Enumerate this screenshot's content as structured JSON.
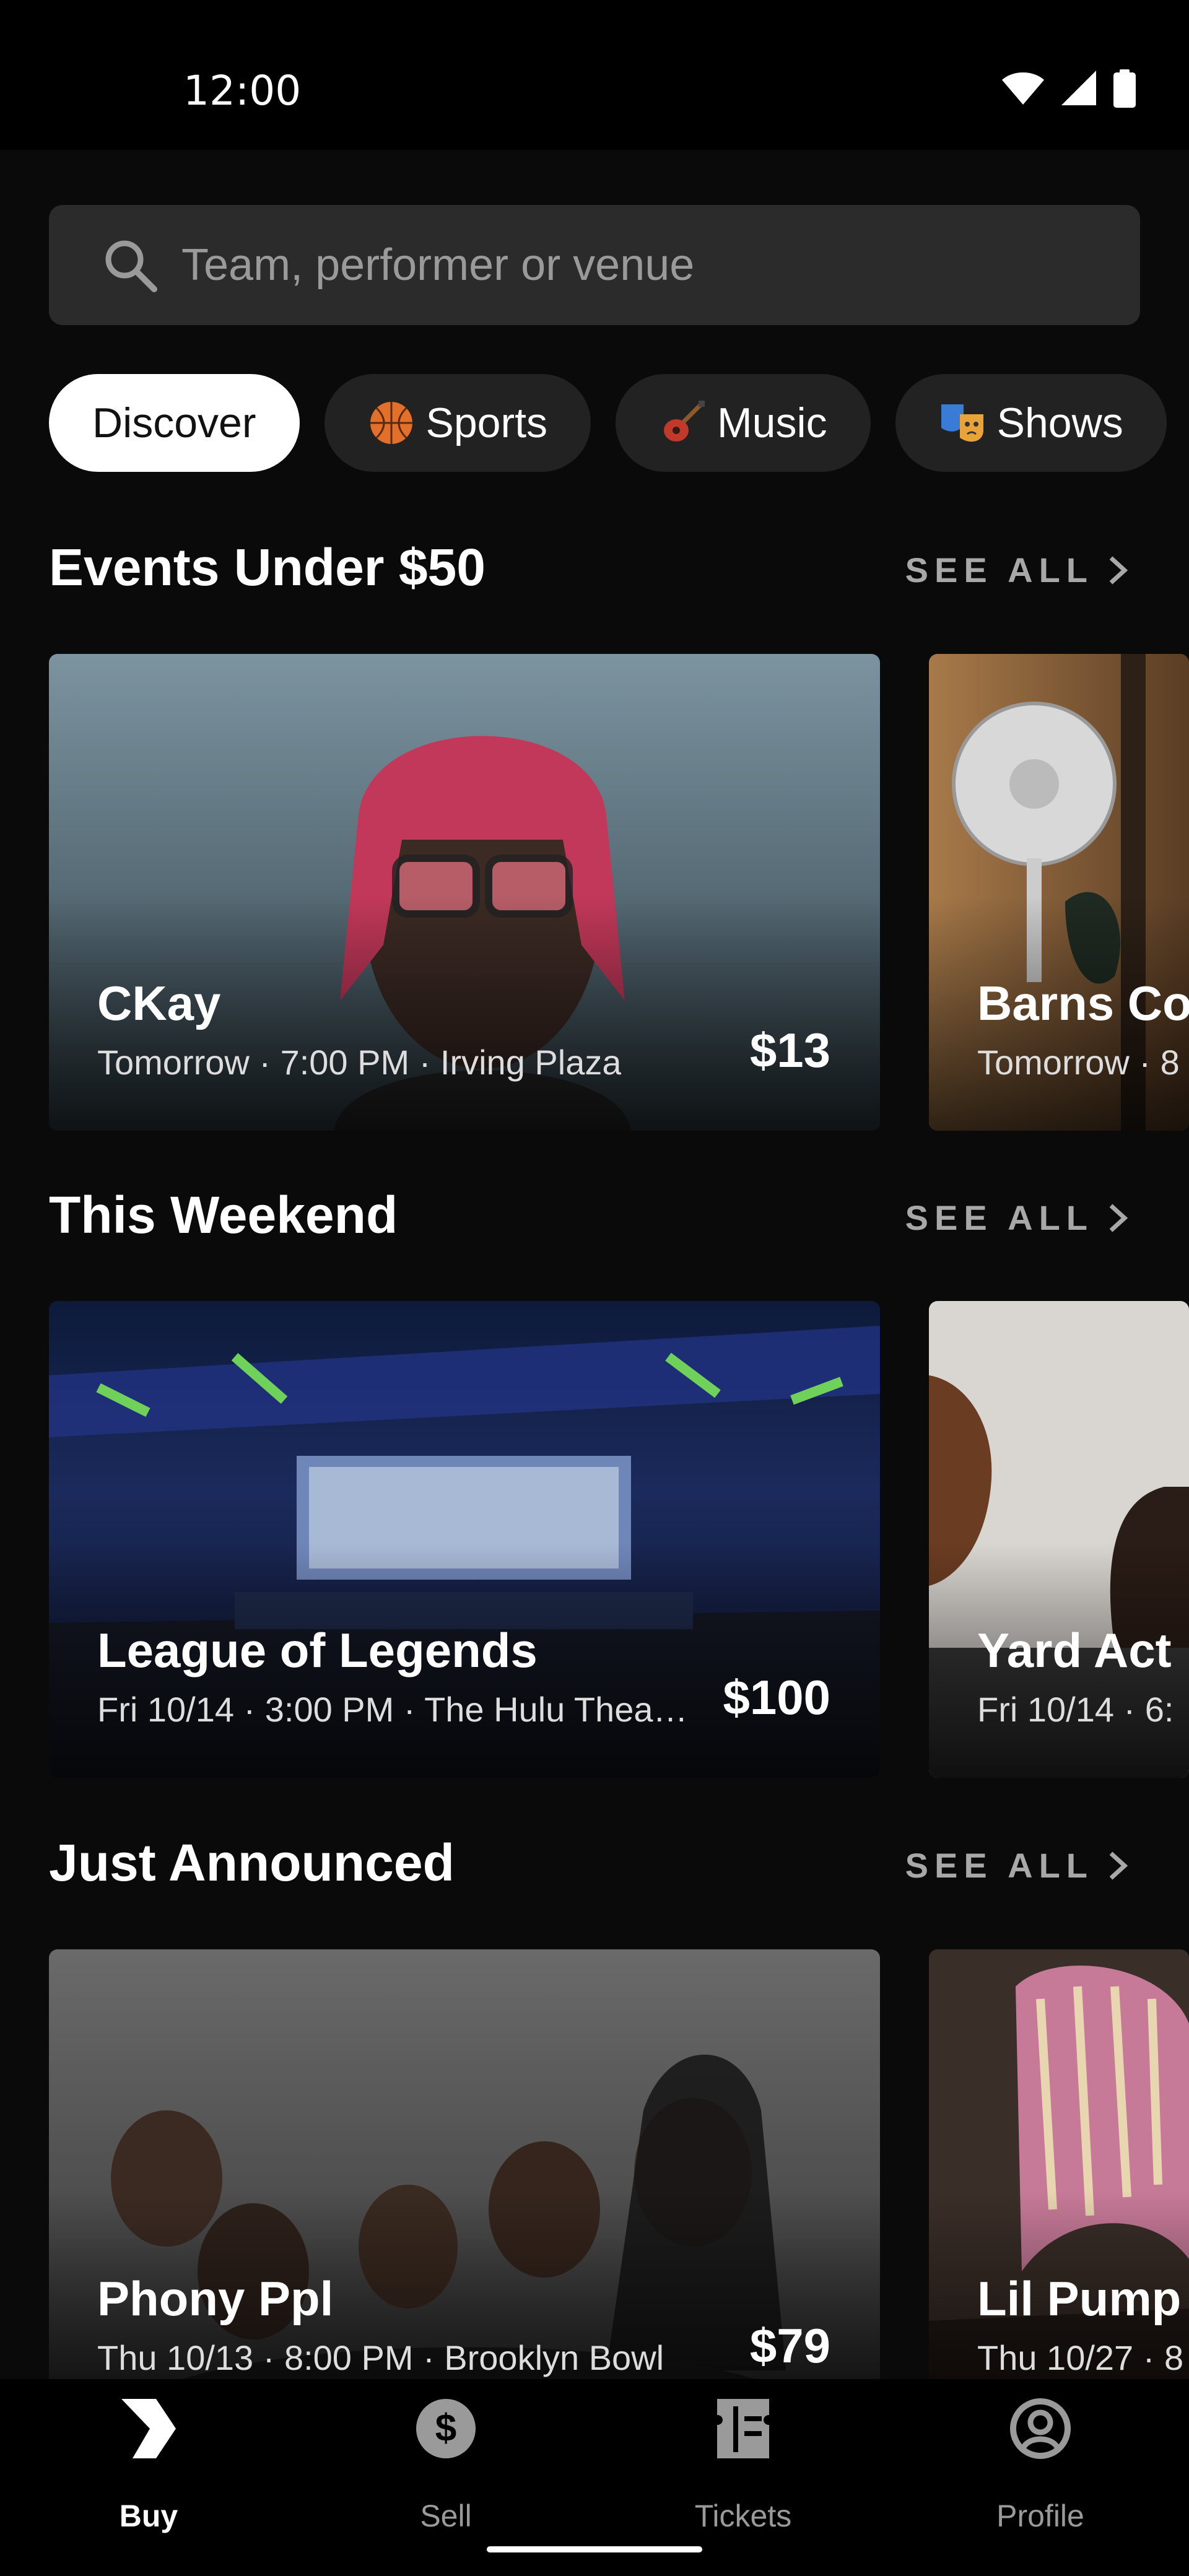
{
  "status_bar": {
    "time": "12:00"
  },
  "search": {
    "placeholder": "Team, performer or venue"
  },
  "chips": [
    {
      "label": "Discover",
      "icon": ""
    },
    {
      "label": "Sports",
      "icon": "basketball-icon"
    },
    {
      "label": "Music",
      "icon": "guitar-icon"
    },
    {
      "label": "Shows",
      "icon": "theater-masks-icon"
    }
  ],
  "sections": [
    {
      "title": "Events Under $50",
      "see_all": "SEE ALL",
      "cards": [
        {
          "name": "CKay",
          "meta": "Tomorrow · 7:00 PM · Irving Plaza",
          "price": "$13"
        },
        {
          "name": "Barns Cou",
          "meta": "Tomorrow · 8"
        }
      ]
    },
    {
      "title": "This Weekend",
      "see_all": "SEE ALL",
      "cards": [
        {
          "name": "League of Legends",
          "meta": "Fri 10/14 · 3:00 PM · The Hulu Thea…",
          "price": "$100"
        },
        {
          "name": "Yard Act",
          "meta": "Fri 10/14 · 6:"
        }
      ]
    },
    {
      "title": "Just Announced",
      "see_all": "SEE ALL",
      "cards": [
        {
          "name": "Phony Ppl",
          "meta": "Thu 10/13 · 8:00 PM · Brooklyn Bowl",
          "price": "$79"
        },
        {
          "name": "Lil Pump",
          "meta": "Thu 10/27 · 8"
        }
      ]
    }
  ],
  "bottom_nav": [
    {
      "label": "Buy",
      "icon": "buy-logo-icon",
      "active": true
    },
    {
      "label": "Sell",
      "icon": "dollar-icon",
      "active": false
    },
    {
      "label": "Tickets",
      "icon": "ticket-icon",
      "active": false
    },
    {
      "label": "Profile",
      "icon": "profile-icon",
      "active": false
    }
  ],
  "colors": {
    "background": "#0a0a0a",
    "search_bg": "#2b2b2b",
    "chip_bg": "#222222",
    "accent": "#ffffff",
    "muted": "#a8a8a8"
  }
}
